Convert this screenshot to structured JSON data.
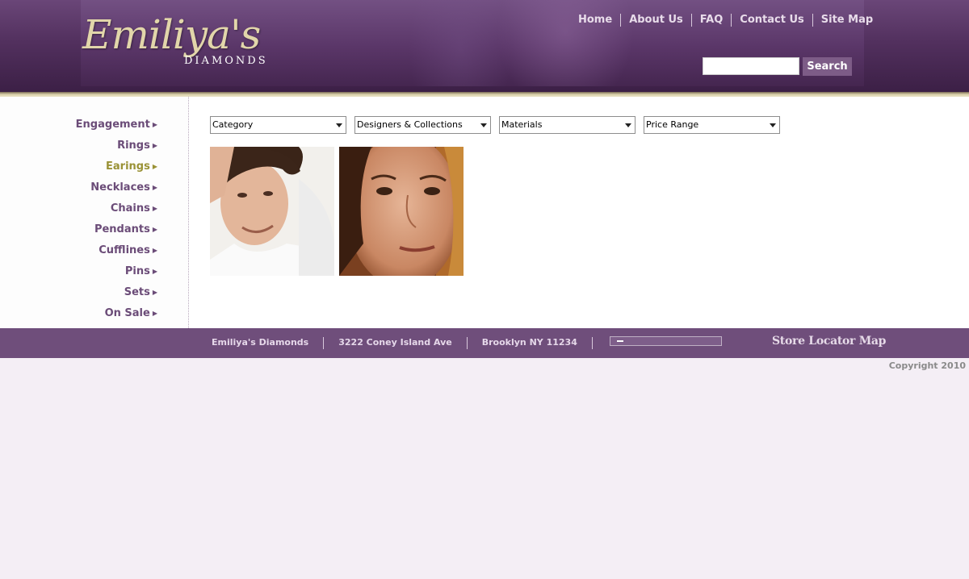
{
  "brand": {
    "logo_script": "Emiliya's",
    "logo_sub": "DIAMONDS"
  },
  "topnav": [
    {
      "label": "Home"
    },
    {
      "label": "About Us"
    },
    {
      "label": "FAQ"
    },
    {
      "label": "Contact Us"
    },
    {
      "label": "Site Map"
    }
  ],
  "search": {
    "value": "",
    "button_label": "Search"
  },
  "sidebar": {
    "items": [
      {
        "label": "Engagement",
        "active": false
      },
      {
        "label": "Rings",
        "active": false
      },
      {
        "label": "Earings",
        "active": true
      },
      {
        "label": "Necklaces",
        "active": false
      },
      {
        "label": "Chains",
        "active": false
      },
      {
        "label": "Pendants",
        "active": false
      },
      {
        "label": "Cufflines",
        "active": false
      },
      {
        "label": "Pins",
        "active": false
      },
      {
        "label": "Sets",
        "active": false
      },
      {
        "label": "On Sale",
        "active": false
      }
    ]
  },
  "filters": [
    {
      "selected": "Category"
    },
    {
      "selected": "Designers & Collections"
    },
    {
      "selected": "Materials"
    },
    {
      "selected": "Price Range"
    }
  ],
  "photos": [
    {
      "name": "man-portrait"
    },
    {
      "name": "woman-portrait"
    }
  ],
  "footer": {
    "items": [
      "Emiliya's Diamonds",
      "3222 Coney Island Ave",
      "Brooklyn NY 11234"
    ],
    "store_locator": "Store Locator Map",
    "copyright": "Copyright 2010"
  },
  "colors": {
    "header_purple": "#52305e",
    "footer_purple": "#6f4e7b",
    "nav_text": "#6b4c78",
    "active_nav": "#9a9236",
    "page_bg": "#f4eef5"
  }
}
